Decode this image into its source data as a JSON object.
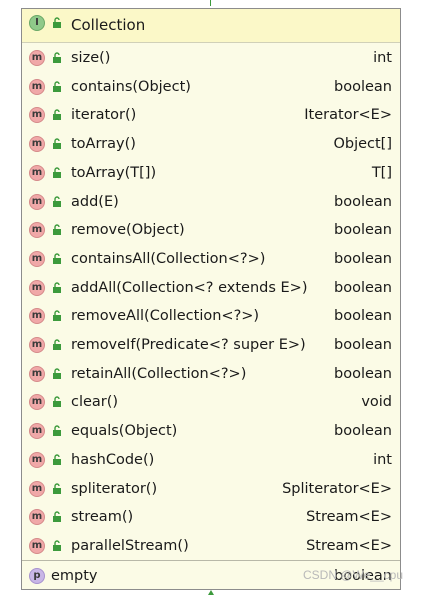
{
  "panel": {
    "header": {
      "badge": "I",
      "title": "Collection"
    },
    "methods": [
      {
        "badge": "m",
        "name": "size()",
        "type": "int"
      },
      {
        "badge": "m",
        "name": "contains(Object)",
        "type": "boolean"
      },
      {
        "badge": "m",
        "name": "iterator()",
        "type": "Iterator<E>"
      },
      {
        "badge": "m",
        "name": "toArray()",
        "type": "Object[]"
      },
      {
        "badge": "m",
        "name": "toArray(T[])",
        "type": "T[]"
      },
      {
        "badge": "m",
        "name": "add(E)",
        "type": "boolean"
      },
      {
        "badge": "m",
        "name": "remove(Object)",
        "type": "boolean"
      },
      {
        "badge": "m",
        "name": "containsAll(Collection<?>)",
        "type": "boolean"
      },
      {
        "badge": "m",
        "name": "addAll(Collection<? extends E>)",
        "type": "boolean"
      },
      {
        "badge": "m",
        "name": "removeAll(Collection<?>)",
        "type": "boolean"
      },
      {
        "badge": "m",
        "name": "removeIf(Predicate<? super E>)",
        "type": "boolean"
      },
      {
        "badge": "m",
        "name": "retainAll(Collection<?>)",
        "type": "boolean"
      },
      {
        "badge": "m",
        "name": "clear()",
        "type": "void"
      },
      {
        "badge": "m",
        "name": "equals(Object)",
        "type": "boolean"
      },
      {
        "badge": "m",
        "name": "hashCode()",
        "type": "int"
      },
      {
        "badge": "m",
        "name": "spliterator()",
        "type": "Spliterator<E>"
      },
      {
        "badge": "m",
        "name": "stream()",
        "type": "Stream<E>"
      },
      {
        "badge": "m",
        "name": "parallelStream()",
        "type": "Stream<E>"
      }
    ],
    "property": {
      "badge": "p",
      "name": "empty",
      "type": "boolean"
    }
  },
  "watermark": "CSDN @We__cpu",
  "colors": {
    "panel_bg": "#fbfbe6",
    "header_bg": "#fbf8c8",
    "method_badge": "#f0a8a8",
    "interface_badge": "#8fc98a",
    "property_badge": "#c8b6e6",
    "lock_green": "#3c9a3c"
  },
  "icons": {
    "interface": "interface-icon",
    "method": "method-icon",
    "property": "property-icon",
    "visibility": "public-lock-icon"
  }
}
